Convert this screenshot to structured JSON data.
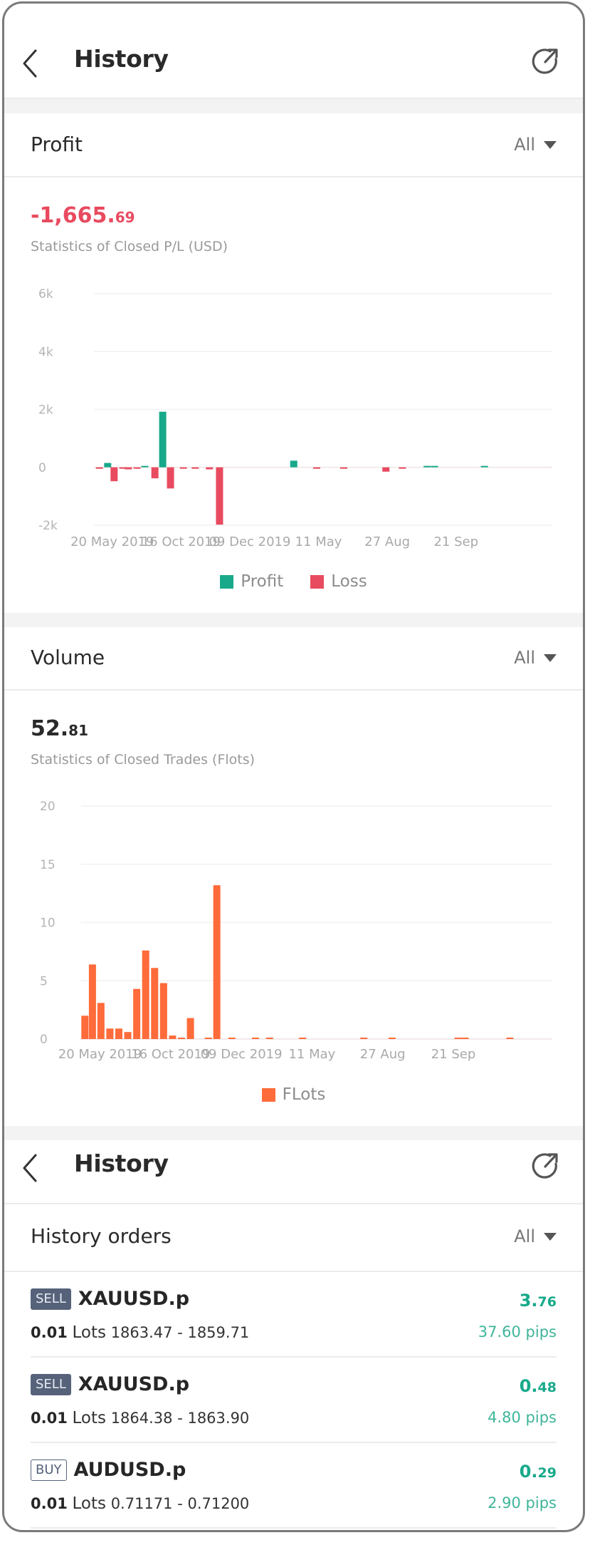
{
  "header": {
    "title": "History",
    "back_icon": "chevron-left-icon",
    "share_icon": "share-external-icon"
  },
  "profit_section": {
    "title": "Profit",
    "filter_label": "All",
    "total_int": "-1,665.",
    "total_dec": "69",
    "subtitle": "Statistics of Closed P/L (USD)",
    "legend": [
      {
        "label": "Profit",
        "color": "#17a98a"
      },
      {
        "label": "Loss",
        "color": "#e84a5f"
      }
    ]
  },
  "volume_section": {
    "title": "Volume",
    "filter_label": "All",
    "total_int": "52.",
    "total_dec": "81",
    "subtitle": "Statistics of Closed Trades (Flots)",
    "legend": [
      {
        "label": "FLots",
        "color": "#ff6b3a"
      }
    ]
  },
  "second_header": {
    "title": "History"
  },
  "orders_section": {
    "title": "History orders",
    "filter_label": "All",
    "orders": [
      {
        "side": "SELL",
        "symbol": "XAUUSD.p",
        "lots": "0.01",
        "lots_label": "Lots",
        "prices": "1863.47 - 1859.71",
        "pl_int": "3.",
        "pl_dec": "76",
        "pips": "37.60 pips"
      },
      {
        "side": "SELL",
        "symbol": "XAUUSD.p",
        "lots": "0.01",
        "lots_label": "Lots",
        "prices": "1864.38 - 1863.90",
        "pl_int": "0.",
        "pl_dec": "48",
        "pips": "4.80 pips"
      },
      {
        "side": "BUY",
        "symbol": "AUDUSD.p",
        "lots": "0.01",
        "lots_label": "Lots",
        "prices": "0.71171 - 0.71200",
        "pl_int": "0.",
        "pl_dec": "29",
        "pips": "2.90 pips"
      }
    ]
  },
  "chart_data": [
    {
      "type": "bar",
      "title": "Statistics of Closed P/L (USD)",
      "xlabel": "",
      "ylabel": "",
      "ylim": [
        -2000,
        6000
      ],
      "yticks": [
        6000,
        4000,
        2000,
        0,
        -2000
      ],
      "ytick_labels": [
        "6k",
        "4k",
        "2k",
        "0",
        "-2k"
      ],
      "xtick_labels": [
        "20 May 2019",
        "16 Oct 2019",
        "09 Dec 2019",
        "11 May",
        "27 Aug",
        "21 Sep"
      ],
      "grid": true,
      "legend_position": "bottom-center",
      "series": [
        {
          "name": "Profit",
          "color": "#17a98a"
        },
        {
          "name": "Loss",
          "color": "#e84a5f"
        }
      ],
      "x_range": [
        0,
        100
      ],
      "x_ticks": [
        4,
        19,
        34,
        49,
        64,
        79
      ],
      "points": [
        {
          "x": 1.2,
          "value": -50
        },
        {
          "x": 3.0,
          "value": 150
        },
        {
          "x": 4.4,
          "value": -480
        },
        {
          "x": 6.3,
          "value": -20
        },
        {
          "x": 7.5,
          "value": -70
        },
        {
          "x": 9.4,
          "value": -20
        },
        {
          "x": 11.1,
          "value": 30
        },
        {
          "x": 13.3,
          "value": -380
        },
        {
          "x": 15.0,
          "value": 1920
        },
        {
          "x": 16.7,
          "value": -730
        },
        {
          "x": 19.5,
          "value": -10
        },
        {
          "x": 22.1,
          "value": -20
        },
        {
          "x": 25.2,
          "value": -70
        },
        {
          "x": 27.4,
          "value": -1980
        },
        {
          "x": 43.6,
          "value": 230
        },
        {
          "x": 48.6,
          "value": -10
        },
        {
          "x": 54.5,
          "value": -20
        },
        {
          "x": 63.7,
          "value": -150
        },
        {
          "x": 67.3,
          "value": -20
        },
        {
          "x": 72.7,
          "value": 30
        },
        {
          "x": 74.3,
          "value": 20
        },
        {
          "x": 85.2,
          "value": 20
        }
      ]
    },
    {
      "type": "bar",
      "title": "Statistics of Closed Trades (Flots)",
      "xlabel": "",
      "ylabel": "",
      "ylim": [
        0,
        20
      ],
      "yticks": [
        20,
        15,
        10,
        5,
        0
      ],
      "ytick_labels": [
        "20",
        "15",
        "10",
        "5",
        "0"
      ],
      "xtick_labels": [
        "20 May 2019",
        "16 Oct 2019",
        "09 Dec 2019",
        "11 May",
        "27 Aug",
        "21 Sep"
      ],
      "grid": true,
      "legend_position": "bottom-center",
      "series": [
        {
          "name": "FLots",
          "color": "#ff6b3a"
        }
      ],
      "x_range": [
        0,
        100
      ],
      "x_ticks": [
        4,
        19,
        34,
        49,
        64,
        79
      ],
      "points": [
        {
          "x": 0.8,
          "value": 2.0
        },
        {
          "x": 2.4,
          "value": 6.4
        },
        {
          "x": 4.2,
          "value": 3.1
        },
        {
          "x": 6.1,
          "value": 0.9
        },
        {
          "x": 8.0,
          "value": 0.9
        },
        {
          "x": 9.9,
          "value": 0.6
        },
        {
          "x": 11.8,
          "value": 4.3
        },
        {
          "x": 13.7,
          "value": 7.6
        },
        {
          "x": 15.6,
          "value": 6.1
        },
        {
          "x": 17.5,
          "value": 4.8
        },
        {
          "x": 19.4,
          "value": 0.3
        },
        {
          "x": 21.3,
          "value": 0.1
        },
        {
          "x": 23.2,
          "value": 1.8
        },
        {
          "x": 27.0,
          "value": 0.1
        },
        {
          "x": 28.8,
          "value": 13.2
        },
        {
          "x": 32.0,
          "value": 0.08
        },
        {
          "x": 37.0,
          "value": 0.05
        },
        {
          "x": 40.0,
          "value": 0.05
        },
        {
          "x": 47.0,
          "value": 0.08
        },
        {
          "x": 60.0,
          "value": 0.05
        },
        {
          "x": 66.0,
          "value": 0.05
        },
        {
          "x": 80.0,
          "value": 0.1
        },
        {
          "x": 81.5,
          "value": 0.08
        },
        {
          "x": 91.0,
          "value": 0.05
        }
      ]
    }
  ]
}
